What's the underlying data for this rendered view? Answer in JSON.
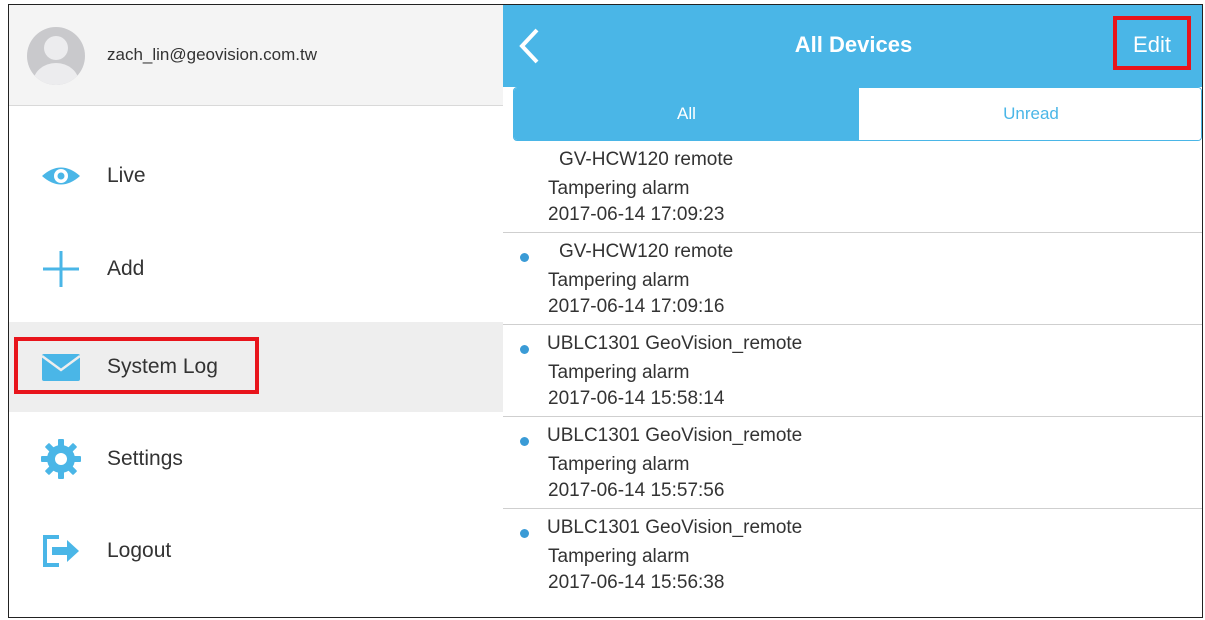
{
  "profile": {
    "email": "zach_lin@geovision.com.tw"
  },
  "menu": [
    {
      "label": "Live",
      "icon": "eye-icon"
    },
    {
      "label": "Add",
      "icon": "plus-icon"
    },
    {
      "label": "System Log",
      "icon": "envelope-icon"
    },
    {
      "label": "Settings",
      "icon": "gear-icon"
    },
    {
      "label": "Logout",
      "icon": "logout-icon"
    }
  ],
  "header": {
    "title": "All Devices",
    "edit_label": "Edit"
  },
  "filter": {
    "all_label": "All",
    "unread_label": "Unread",
    "selected": "All"
  },
  "logs": [
    {
      "device": "GV-HCW120  remote",
      "event": "Tampering alarm",
      "time": "2017-06-14 17:09:23",
      "unread": false
    },
    {
      "device": "GV-HCW120  remote",
      "event": "Tampering alarm",
      "time": "2017-06-14 17:09:16",
      "unread": true
    },
    {
      "device": "UBLC1301 GeoVision_remote",
      "event": "Tampering alarm",
      "time": "2017-06-14 15:58:14",
      "unread": true
    },
    {
      "device": "UBLC1301 GeoVision_remote",
      "event": "Tampering alarm",
      "time": "2017-06-14 15:57:56",
      "unread": true
    },
    {
      "device": "UBLC1301 GeoVision_remote",
      "event": "Tampering alarm",
      "time": "2017-06-14 15:56:38",
      "unread": true
    }
  ],
  "colors": {
    "accent": "#4ab6e7",
    "highlight": "#e8141b",
    "unread_dot": "#3a9bd6"
  }
}
